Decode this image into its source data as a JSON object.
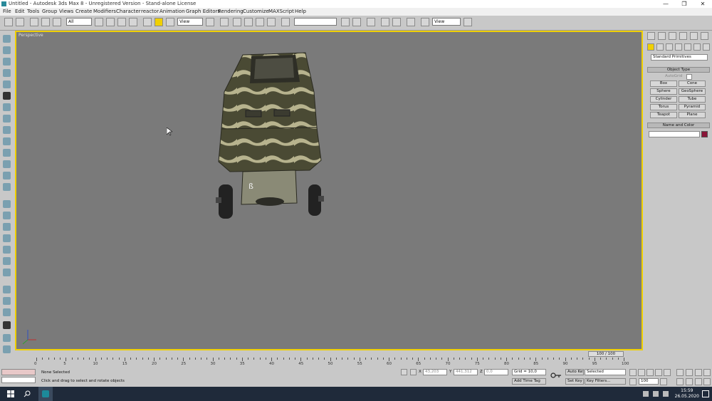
{
  "window": {
    "title": "Untitled - Autodesk 3ds Max 8 - Unregistered Version - Stand-alone License",
    "controls": [
      "—",
      "❐",
      "✕"
    ]
  },
  "menu": [
    "File",
    "Edit",
    "Tools",
    "Group",
    "Views",
    "Create",
    "Modifiers",
    "Character",
    "reactor",
    "Animation",
    "Graph Editors",
    "Rendering",
    "Customize",
    "MAXScript",
    "Help"
  ],
  "toolbar": {
    "selection_filter": "All",
    "ref_coord": "View",
    "named_selection": "",
    "render_type": "View"
  },
  "viewport": {
    "label": "Perspective",
    "background": "#7a7a7a",
    "border_color": "#f0d000"
  },
  "command_panel": {
    "category": "Standard Primitives",
    "object_type_title": "Object Type",
    "autogrid_label": "AutoGrid",
    "buttons": [
      "Box",
      "Cone",
      "Sphere",
      "GeoSphere",
      "Cylinder",
      "Tube",
      "Torus",
      "Pyramid",
      "Teapot",
      "Plane"
    ],
    "name_color_title": "Name and Color",
    "name_value": "",
    "object_color": "#8a1538"
  },
  "timeline": {
    "slider_label": "100 / 100",
    "current_frame": 100,
    "ticks": [
      0,
      5,
      10,
      15,
      20,
      25,
      30,
      35,
      40,
      45,
      50,
      55,
      60,
      65,
      70,
      75,
      80,
      85,
      90,
      95,
      100
    ]
  },
  "status": {
    "selection": "None Selected",
    "prompt": "Click and drag to select and rotate objects",
    "x_label": "X",
    "x_value": "43,203",
    "y_label": "Y",
    "y_value": "441,312",
    "z_label": "Z",
    "z_value": "0,0",
    "grid": "Grid = 10,0",
    "add_time_tag": "Add Time Tag",
    "auto_key": "Auto Key",
    "set_key": "Set Key",
    "key_mode": "Selected",
    "key_filters": "Key Filters...",
    "frame_field": "100"
  },
  "taskbar": {
    "time": "15:59",
    "date": "26.05.2020"
  }
}
